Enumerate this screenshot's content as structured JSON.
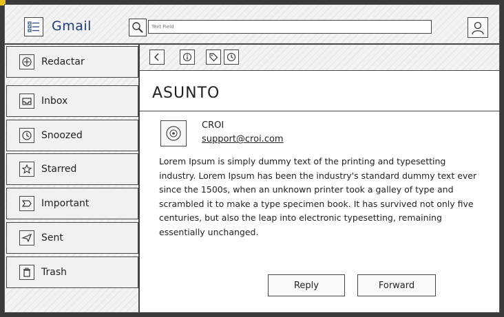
{
  "header": {
    "app_title": "Gmail",
    "search_placeholder": "Text Field",
    "icons": {
      "menu": "list-icon",
      "search": "magnifier-icon",
      "user": "user-avatar-icon"
    }
  },
  "sidebar": {
    "items": [
      {
        "label": "Redactar",
        "icon": "compose-icon"
      },
      {
        "label": "Inbox",
        "icon": "inbox-icon"
      },
      {
        "label": "Snoozed",
        "icon": "clock-icon"
      },
      {
        "label": "Starred",
        "icon": "star-icon"
      },
      {
        "label": "Important",
        "icon": "important-icon"
      },
      {
        "label": "Sent",
        "icon": "send-icon"
      },
      {
        "label": "Trash",
        "icon": "trash-icon"
      }
    ]
  },
  "toolbar": {
    "icons": [
      "back-icon",
      "info-icon",
      "tag-icon",
      "clock-icon"
    ]
  },
  "message": {
    "subject": "ASUNTO",
    "sender_name": "CROI",
    "sender_email": "support@croi.com",
    "body": "Lorem Ipsum is simply dummy text of the printing and typesetting industry. Lorem Ipsum has been the industry's standard dummy text ever since the 1500s, when an unknown printer took a galley of type and scrambled it to make a type specimen book. It has survived not only five centuries, but also the leap into electronic typesetting, remaining essentially unchanged."
  },
  "actions": {
    "reply_label": "Reply",
    "forward_label": "Forward"
  },
  "colors": {
    "title_blue": "#1a3a7a",
    "corner_marker": "#e8c11a"
  }
}
